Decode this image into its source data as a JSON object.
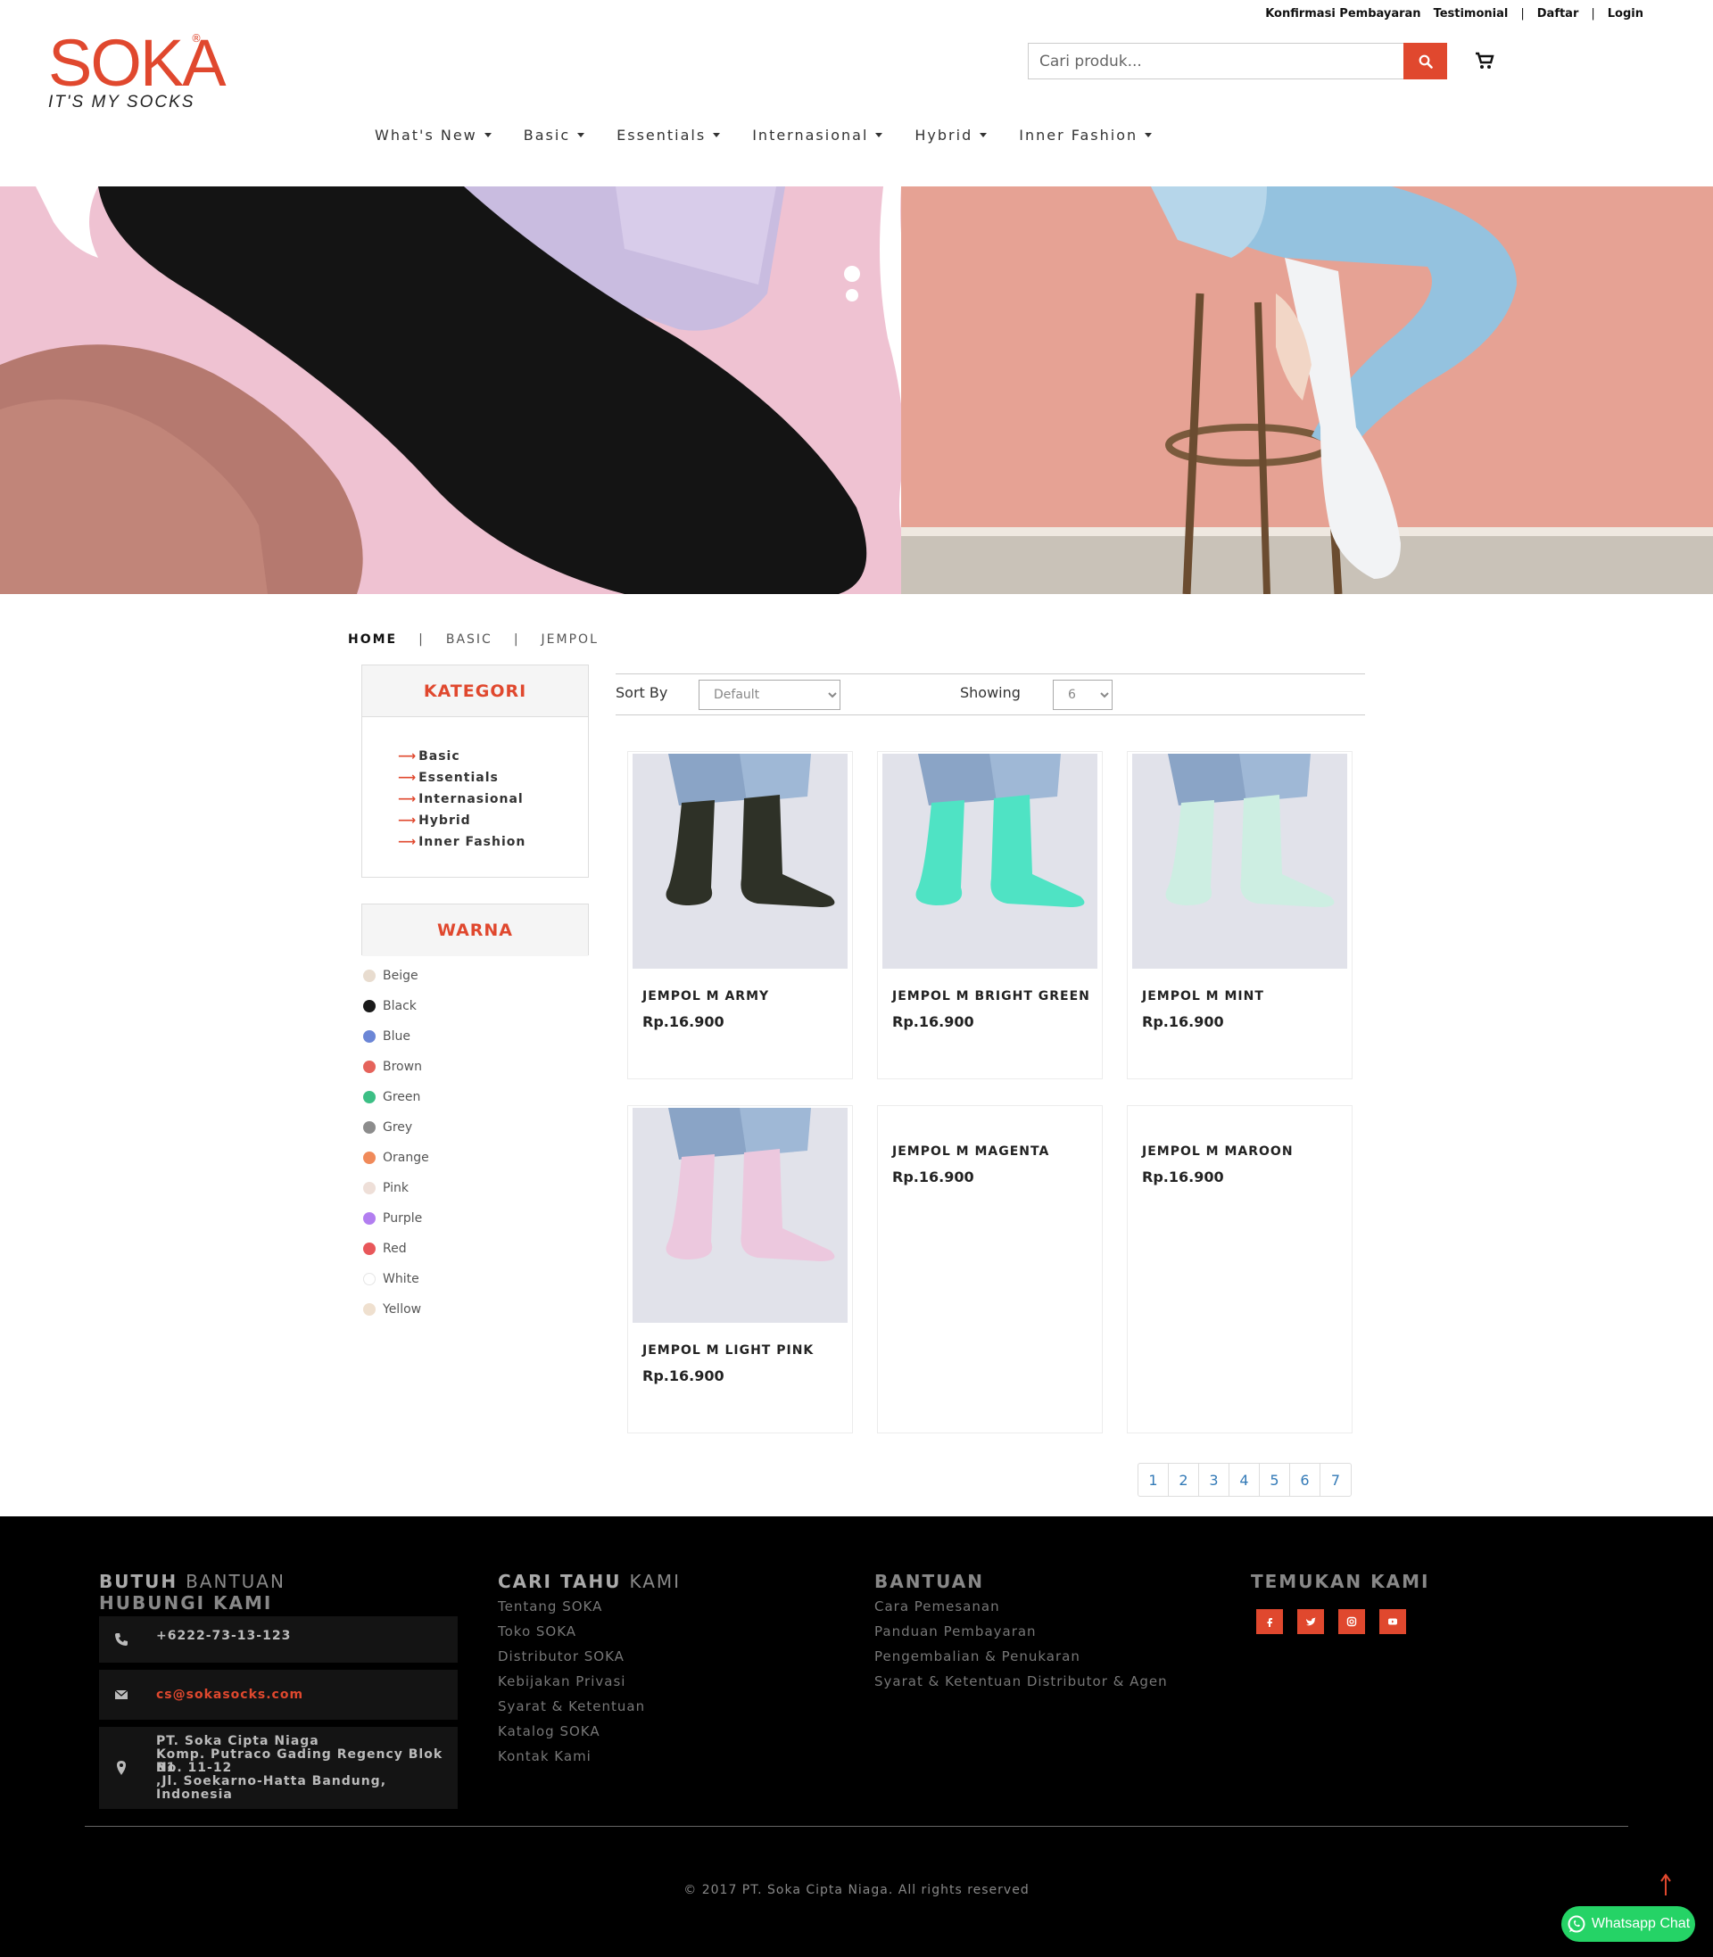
{
  "util_bar": {
    "links": [
      "Konfirmasi Pembayaran",
      "Testimonial",
      "Daftar",
      "Login"
    ]
  },
  "logo": {
    "word": "SOKA",
    "reg": "®",
    "tagline": "IT'S MY SOCKS"
  },
  "search": {
    "placeholder": "Cari produk..."
  },
  "nav": {
    "items": [
      "What's New",
      "Basic",
      "Essentials",
      "Internasional",
      "Hybrid",
      "Inner Fashion"
    ]
  },
  "breadcrumb": {
    "home": "HOME",
    "level1": "BASIC",
    "level2": "JEMPOL",
    "sep": "|"
  },
  "sidebar": {
    "kategori_title": "KATEGORI",
    "kategori": [
      "Basic",
      "Essentials",
      "Internasional",
      "Hybrid",
      "Inner Fashion"
    ],
    "warna_title": "WARNA",
    "warna": [
      {
        "name": "Beige",
        "color": "#e8dccf"
      },
      {
        "name": "Black",
        "color": "#1a1a1a"
      },
      {
        "name": "Blue",
        "color": "#6b86d6"
      },
      {
        "name": "Brown",
        "color": "#e5635b"
      },
      {
        "name": "Green",
        "color": "#3cbf85"
      },
      {
        "name": "Grey",
        "color": "#8c8c8c"
      },
      {
        "name": "Orange",
        "color": "#f08a5a"
      },
      {
        "name": "Pink",
        "color": "#eedfd8"
      },
      {
        "name": "Purple",
        "color": "#b27ef0"
      },
      {
        "name": "Red",
        "color": "#e8575a"
      },
      {
        "name": "White",
        "color": "#ffffff"
      },
      {
        "name": "Yellow",
        "color": "#efe0cf"
      }
    ]
  },
  "toolbar": {
    "sort_label": "Sort By",
    "sort_value": "Default",
    "showing_label": "Showing",
    "showing_value": "6"
  },
  "products": [
    {
      "name": "JEMPOL M ARMY",
      "price": "Rp.16.900",
      "sock_color": "#2e3127"
    },
    {
      "name": "JEMPOL M BRIGHT GREEN",
      "price": "Rp.16.900",
      "sock_color": "#4fe3c4"
    },
    {
      "name": "JEMPOL M MINT",
      "price": "Rp.16.900",
      "sock_color": "#cdeee2"
    },
    {
      "name": "JEMPOL M LIGHT PINK",
      "price": "Rp.16.900",
      "sock_color": "#ecc8de"
    },
    {
      "name": "JEMPOL M MAGENTA",
      "price": "Rp.16.900",
      "sock_color": ""
    },
    {
      "name": "JEMPOL M MAROON",
      "price": "Rp.16.900",
      "sock_color": ""
    }
  ],
  "pagination": [
    "1",
    "2",
    "3",
    "4",
    "5",
    "6",
    "7"
  ],
  "footer": {
    "help_title_bold": "BUTUH",
    "help_title_thin": "BANTUAN",
    "help_title_2": "HUBUNGI KAMI",
    "phone": "+6222-73-13-123",
    "email": "cs@sokasocks.com",
    "address": [
      "PT. Soka Cipta Niaga",
      "Komp. Putraco Gading Regency Blok B1",
      "No. 11-12",
      ",Jl. Soekarno-Hatta Bandung, Indonesia"
    ],
    "cari_title_bold": "CARI TAHU",
    "cari_title_thin": "KAMI",
    "cari_links": [
      "Tentang SOKA",
      "Toko SOKA",
      "Distributor SOKA",
      "Kebijakan Privasi",
      "Syarat & Ketentuan",
      "Katalog SOKA",
      "Kontak Kami"
    ],
    "bantuan_title": "BANTUAN",
    "bantuan_links": [
      "Cara Pemesanan",
      "Panduan Pembayaran",
      "Pengembalian & Penukaran",
      "Syarat & Ketentuan Distributor & Agen"
    ],
    "temukan_title": "TEMUKAN KAMI",
    "social": [
      "facebook-icon",
      "twitter-icon",
      "instagram-icon",
      "youtube-icon"
    ],
    "copyright": "© 2017 PT. Soka Cipta Niaga. All rights reserved"
  },
  "whatsapp": {
    "label": "Whatsapp Chat"
  }
}
